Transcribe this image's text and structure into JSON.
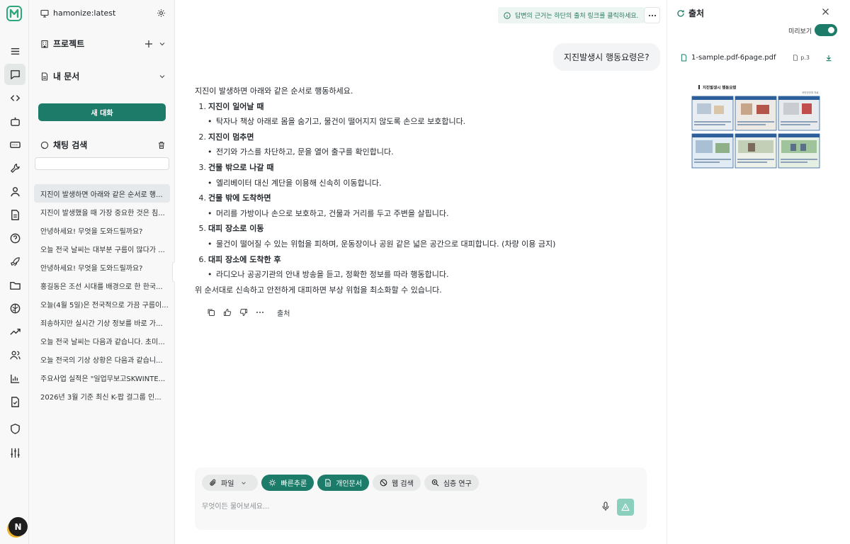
{
  "rail": {
    "items": [
      "menu-icon",
      "chat-icon",
      "code-icon",
      "bot-icon",
      "terminal-icon",
      "wrench-icon",
      "user-icon",
      "document-icon",
      "help-icon",
      "rocket-icon",
      "folder-icon",
      "brain-icon",
      "trend-icon",
      "users-icon",
      "chart-icon",
      "checklist-icon",
      "shield-icon",
      "sliders-icon"
    ],
    "avatar_letter": "N"
  },
  "sidebar": {
    "workspace": "hamonize:latest",
    "projects_label": "프로젝트",
    "my_docs_label": "내 문서",
    "new_chat_label": "새 대화",
    "chat_search_label": "채팅 검색",
    "history": [
      "지진이 발생하면 아래와 같은 순서로 행...",
      "지진이 발생했을 때 가장 중요한 것은 침...",
      "안녕하세요! 무엇을 도와드릴까요?",
      "오늘 전국 날씨는 대부분 구름이 많다가 ...",
      "안녕하세요! 무엇을 도와드릴까요?",
      "홍길동은 조선 시대를 배경으로 한 한국...",
      "오늘(4월 5일)은 전국적으로 가끔 구름이...",
      "죄송하지만 실시간 기상 정보를 바로 가...",
      "오늘 전국 날씨는 다음과 같습니다. 초미...",
      "오늘 전국의 기상 상황은 다음과 같습니...",
      "주요사업 실적은 \"일업무보고SKWINTE...",
      "2026년 3월 기준 최신 K-팝 걸그룹 인..."
    ]
  },
  "main": {
    "tip": "답변의 근거는 하단의 출처 링크를 클릭하세요.",
    "question": "지진발생시 행동요령은?",
    "answer_intro": "지진이 발생하면 아래와 같은 순서로 행동하세요.",
    "sections": [
      {
        "num": "1.",
        "title": "지진이 일어날 때",
        "bullet": "탁자나 책상 아래로 몸을 숨기고, 물건이 떨어지지 않도록 손으로 보호합니다."
      },
      {
        "num": "2.",
        "title": "지진이 멈추면",
        "bullet": "전기와 가스를 차단하고, 문을 열어 출구를 확인합니다."
      },
      {
        "num": "3.",
        "title": "건물 밖으로 나갈 때",
        "bullet": "엘리베이터 대신 계단을 이용해 신속히 이동합니다."
      },
      {
        "num": "4.",
        "title": "건물 밖에 도착하면",
        "bullet": "머리를 가방이나 손으로 보호하고, 건물과 거리를 두고 주변을 살핍니다."
      },
      {
        "num": "5.",
        "title": "대피 장소로 이동",
        "bullet": "물건이 떨어질 수 있는 위험을 피하며, 운동장이나 공원 같은 넓은 공간으로 대피합니다. (차량 이용 금지)"
      },
      {
        "num": "6.",
        "title": "대피 장소에 도착한 후",
        "bullet": "라디오나 공공기관의 안내 방송을 듣고, 정확한 정보를 따라 행동합니다."
      }
    ],
    "answer_outro": "위 순서대로 신속하고 안전하게 대피하면 부상 위험을 최소화할 수 있습니다.",
    "source_label": "출처"
  },
  "composer": {
    "file_label": "파일",
    "fast_reasoning_label": "빠른추론",
    "personal_docs_label": "개인문서",
    "web_search_label": "웹 검색",
    "deep_research_label": "심층 연구",
    "placeholder": "무엇이든 물어보세요..."
  },
  "panel": {
    "title": "출처",
    "preview_label": "미리보기",
    "preview_on": true,
    "file_name": "1-sample.pdf-6page.pdf",
    "page": "p.3",
    "thumb_heading": "지진발생시 행동요령",
    "thumb_corner": "국민안전처 자료"
  },
  "colors": {
    "accent": "#1c7c69",
    "tip_bg": "#ecf5f2",
    "send_disabled": "#8ad0bd"
  }
}
